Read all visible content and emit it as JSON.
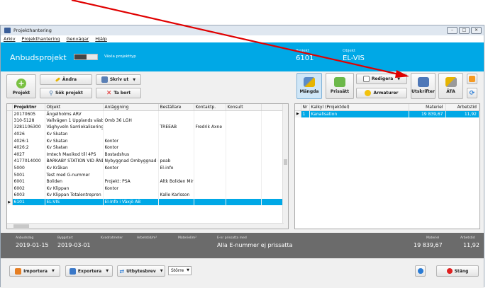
{
  "window": {
    "title": "Projekthantering",
    "controls": [
      "–",
      "□",
      "✕"
    ]
  },
  "menu": [
    "Arkiv",
    "Projekthantering",
    "Genvägar",
    "Hjälp"
  ],
  "banner": {
    "title": "Anbudsprojekt",
    "toggle_label": "Växla projekttyp",
    "projekt_label": "Projekt",
    "projekt_value": "6101",
    "objekt_label": "Objekt",
    "objekt_value": "EL-VIS"
  },
  "toolbar_left": {
    "projekt": "Projekt",
    "andra": "Ändra",
    "skriv_ut": "Skriv ut",
    "sok_projekt": "Sök projekt",
    "ta_bort": "Ta bort"
  },
  "toolbar_right": {
    "mangda": "Mängda",
    "prissatt": "Prissätt",
    "redigera": "Redigera",
    "armaturer": "Armaturer",
    "utskrifter": "Utskrifter",
    "ata": "ÄTA"
  },
  "projects_table": {
    "columns": [
      "Projektnr",
      "Objekt",
      "Anläggning",
      "Beställare",
      "Kontaktp.",
      "Konsult"
    ],
    "rows": [
      [
        "20170605",
        "Ängelholms ARV",
        "",
        "",
        "",
        ""
      ],
      [
        "310-5128",
        "Vallvägen 1 Upplands väsb",
        "Omb 36 LGH",
        "",
        "",
        ""
      ],
      [
        "3281106300",
        "Väghyveln Samlokalisering",
        "",
        "TREEAB",
        "Fredrik Axne",
        ""
      ],
      [
        "4026",
        "Kv Skatan",
        "",
        "",
        "",
        ""
      ],
      [
        "4026:1",
        "Kv Skatan",
        "Kontor",
        "",
        "",
        ""
      ],
      [
        "4026:2",
        "Kv Skatan",
        "Kontor",
        "",
        "",
        ""
      ],
      [
        "4027",
        "Imtech Maxikod till 4PS",
        "Bostadshus",
        "",
        "",
        ""
      ],
      [
        "4177014000",
        "BARKABY STATION VID ÄNDH",
        "Nybyggnad Ombyggnad etc f",
        "peab",
        "",
        ""
      ],
      [
        "5000",
        "Kv Kråkan",
        "Kontor",
        "El-info",
        "",
        ""
      ],
      [
        "5001",
        "Test med G-nummer",
        "",
        "",
        "",
        ""
      ],
      [
        "6001",
        "Boliden",
        "Projekt: PSA",
        "Altk Boliden Mir",
        "",
        ""
      ],
      [
        "6002",
        "Kv Klippan",
        "Kontor",
        "",
        "",
        ""
      ],
      [
        "6003",
        "Kv Klippan Totalentrepren",
        "",
        "Kalle Karlsson",
        "",
        ""
      ],
      [
        "6101",
        "EL-VIS",
        "El-Info i Växjö AB",
        "",
        "",
        ""
      ]
    ],
    "selected_index": 13
  },
  "calc_table": {
    "columns": [
      "Nr",
      "Kalkyl (Projektdel)",
      "Materiel",
      "Arbetstid"
    ],
    "rows": [
      [
        "1",
        "Kanalisation",
        "19 839,67",
        "11,92"
      ]
    ]
  },
  "status": {
    "anbudsdag_label": "Anbudsdag",
    "anbudsdag": "2019-01-15",
    "byggstart_label": "Byggstart",
    "byggstart": "2019-03-01",
    "kvadratmeter_label": "Kvadratmeter",
    "arbetstid_m2_label": "Arbetstid/m²",
    "materiel_m2_label": "Materiel/m²",
    "enr_label": "E-nr prissatta med",
    "enr_value": "Alla E-nummer ej prissatta",
    "materiel_label": "Materiel",
    "materiel_value": "19 839,67",
    "arbetstid_label": "Arbetstid",
    "arbetstid_value": "11,92"
  },
  "bottom": {
    "importera": "Importera",
    "exportera": "Exportera",
    "utbytesbrev": "Utbytesbrev",
    "size_value": "Större",
    "stang": "Stäng"
  },
  "colors": {
    "accent": "#00a8e6",
    "arrow": "#e00000",
    "status_bg": "#6b6b6b"
  }
}
